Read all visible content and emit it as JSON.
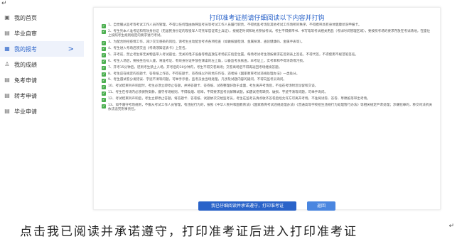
{
  "top_mark": "↵",
  "bottom_mark": "↵",
  "sidebar": {
    "items": [
      {
        "label": "我的首页",
        "icon": "home-icon",
        "glyph": "▣",
        "active": false
      },
      {
        "label": "毕业自审",
        "icon": "doc-icon",
        "glyph": "▤",
        "active": false
      },
      {
        "label": "我的报考",
        "icon": "list-icon",
        "glyph": "▦",
        "active": true
      },
      {
        "label": "我的成绩",
        "icon": "person-icon",
        "glyph": "♙",
        "active": false
      },
      {
        "label": "免考申请",
        "icon": "doc-icon",
        "glyph": "▤",
        "active": false
      },
      {
        "label": "转考申请",
        "icon": "doc-icon",
        "glyph": "▤",
        "active": false
      },
      {
        "label": "毕业申请",
        "icon": "doc-icon",
        "glyph": "▤",
        "active": false
      }
    ],
    "active_chevron": ">"
  },
  "panel": {
    "title": "打印准考证前请仔细阅读以下内容并打钩",
    "rules": [
      "1、自觉服从监考等考试工作人员的管理，不得以任何理由妨碍监考员等考试工作人员履行职责，不得扰乱考场及其他考试工作场所的秩序，不得携带具有身体健康状况申报卡。",
      "2、考生凭本人准考证和有效身份证（无居民身份证的现役军人可凭军官证或士兵证），按规定时间和地点参加考试。考生不得携带书、书写笔等考试相关用品（考试时间管理区域），要按照考场的要求存放在考试场地，在座位上按照考生规则规定的要求进行考试。",
      "3、为配合防控疫情工作，减少交叉感染的风险，请考生主动配合考点各项检查（如做核酸检测、金属探测、查验健康码、金属手表等）。",
      "4、考生进入考场后须交出《考场须知证表卡》上签名。",
      "5、开考前，禁止考生将无关物品带入考试座位，无关的电子设备等物品放在考场前方指定位置。每场考试考生须按要求在签到表上签名，不得代签，不得使用不规范笔签名。",
      "6、考生入场后，要按坐位号入座，将准考证、有效身份证件放在课桌的左上角，以备监考员核查。本考证上，实考率和不得涂改或污损。",
      "7、开考15分钟后，迟到考生禁止入场。开考后的30分钟内，考生不得交卷离场；交卷离场后不得再返回考场继续答题。",
      "8、考生应在规定的答题卡、答卷纸上作答，不得在题卡、答卷纸以外的地方作答，违者按《国家教育考试违规处理办法》一类处分。",
      "9、考生遇试卷分发错误、字迹不清等问题，可举手示意，监考员会当场处理，凡涉及试题内容的疑问，不得向监考员询问。",
      "10、考试结束铃声响起时，考生必须立即停止答题，并将答题卡、答卷纸、试卷整理好放于桌面，考生离开考场后，不准在考场附近逗留和交谈。",
      "11、考生在考场内必须保持安静，遵守考场规则，不得吸烟、喧哗，不得要求监考员解释试题，如遇试卷有缺页、破损、字迹不清等问题，可举手询问。",
      "12、考试结束铃声响后，考生立即停止答题，将答题卡、答卷纸、试题依次交给监考员，考生在监考员清点收齐答卷后经允许方可离开考场，不准将试卷、答卷、草稿纸等带出考场。",
      "13、如不遵守考场规则，不服从考试工作人员管理，有违纪行为的，按照《中华人民共和国教育法》《国家教育考试违规处理办法》《普通高等学校招生违规行为处理暂行办法》等相关规定严肃处理；涉嫌犯罪的，移交司法机关依法追究刑事责任。"
    ],
    "primary_button": "我已仔细阅读并承诺遵守，打印准考证",
    "back_button": "返回"
  },
  "caption": "点击我已阅读并承诺遵守，打印准考证后进入打印准考证"
}
